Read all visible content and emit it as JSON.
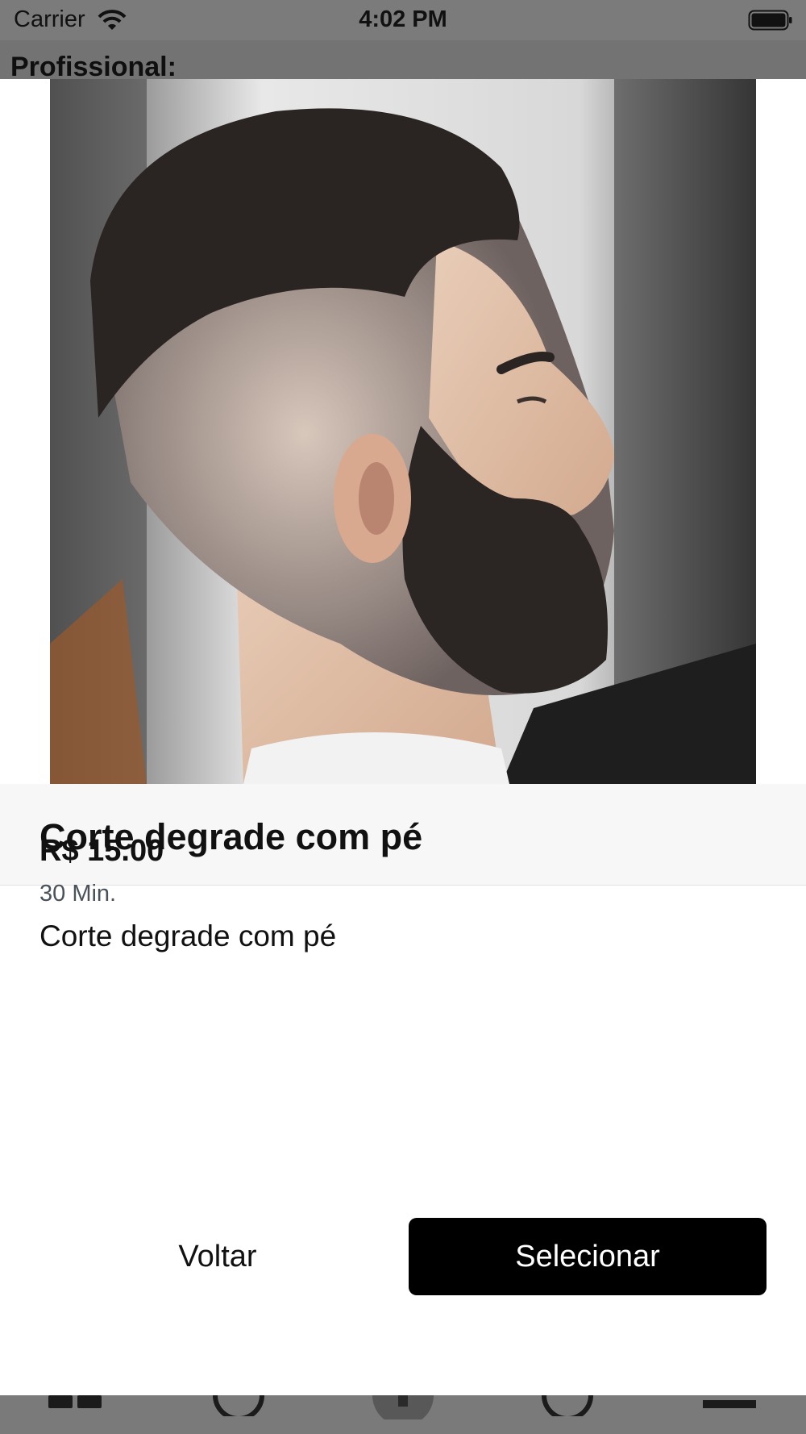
{
  "status_bar": {
    "carrier": "Carrier",
    "time": "4:02 PM",
    "icons": [
      "wifi-icon",
      "battery-icon"
    ]
  },
  "header": {
    "title": "Profissional:"
  },
  "service": {
    "image_icon": "haircut-photo",
    "title": "Corte degrade com pé",
    "price": "R$ 15.00",
    "duration": "30 Min.",
    "description": "Corte degrade com pé"
  },
  "actions": {
    "back_label": "Voltar",
    "select_label": "Selecionar"
  },
  "tab_bar": {
    "icons": [
      "grid-icon",
      "back-circle-icon",
      "center-icon",
      "forward-circle-icon",
      "menu-icon"
    ]
  },
  "colors": {
    "overlay": "#7a7a7a",
    "primary_button": "#000000",
    "title_bar": "#f7f7f7",
    "duration_text": "#4a525a"
  }
}
